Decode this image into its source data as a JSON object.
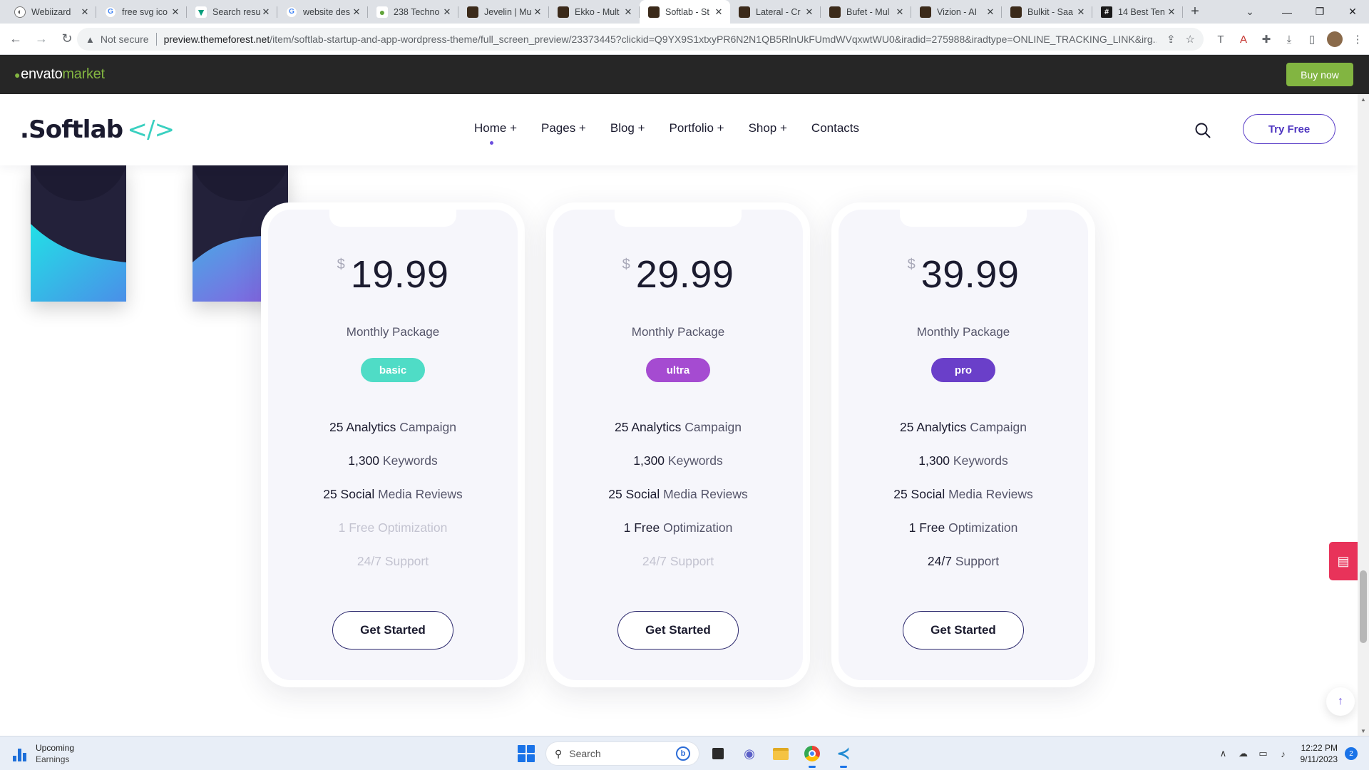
{
  "browser": {
    "tabs": [
      {
        "title": "Webiizard",
        "icon": "webiizard-icon",
        "active": false
      },
      {
        "title": "free svg ico",
        "icon": "google-icon",
        "active": false
      },
      {
        "title": "Search resu",
        "icon": "vector-icon",
        "active": false
      },
      {
        "title": "website des",
        "icon": "google-icon",
        "active": false
      },
      {
        "title": "238 Techno",
        "icon": "leaf-icon",
        "active": false
      },
      {
        "title": "Jevelin | Mu",
        "icon": "envato-icon",
        "active": false
      },
      {
        "title": "Ekko - Mult",
        "icon": "envato-icon",
        "active": false
      },
      {
        "title": "Softlab - St",
        "icon": "envato-icon",
        "active": true
      },
      {
        "title": "Lateral - Cr",
        "icon": "envato-icon",
        "active": false
      },
      {
        "title": "Bufet - Mul",
        "icon": "envato-icon",
        "active": false
      },
      {
        "title": "Vizion - AI",
        "icon": "envato-icon",
        "active": false
      },
      {
        "title": "Bulkit - Saa",
        "icon": "envato-icon",
        "active": false
      },
      {
        "title": "14 Best Ten",
        "icon": "hashnode-icon",
        "active": false
      }
    ],
    "address": {
      "security": "Not secure",
      "host": "preview.themeforest.net",
      "path": "/item/softlab-startup-and-app-wordpress-theme/full_screen_preview/23373445?clickid=Q9YX9S1xtxyPR6N2N1QB5RlnUkFUmdWVqxwtWU0&iradid=275988&iradtype=ONLINE_TRACKING_LINK&irg..."
    }
  },
  "envato": {
    "logo_word": "envato",
    "logo_market": "market",
    "buy_label": "Buy now",
    "accent": "#82b541"
  },
  "site": {
    "brand": ".Softlab",
    "brand_mark": "</>",
    "nav": [
      {
        "label": "Home +",
        "active": true
      },
      {
        "label": "Pages +",
        "active": false
      },
      {
        "label": "Blog +",
        "active": false
      },
      {
        "label": "Portfolio +",
        "active": false
      },
      {
        "label": "Shop +",
        "active": false
      },
      {
        "label": "Contacts",
        "active": false
      }
    ],
    "try_free": "Try Free",
    "accent": "#5a3ec8"
  },
  "pricing": [
    {
      "currency": "$",
      "price": "19.99",
      "package": "Monthly Package",
      "tier": "basic",
      "tier_color": "#4fdcc6",
      "features": [
        {
          "strong": "25 Analytics",
          "rest": " Campaign",
          "enabled": true
        },
        {
          "strong": "1,300",
          "rest": " Keywords",
          "enabled": true
        },
        {
          "strong": "25 Social",
          "rest": " Media Reviews",
          "enabled": true
        },
        {
          "strong": "1 Free",
          "rest": " Optimization",
          "enabled": false
        },
        {
          "strong": "24/7",
          "rest": " Support",
          "enabled": false
        }
      ],
      "cta": "Get Started"
    },
    {
      "currency": "$",
      "price": "29.99",
      "package": "Monthly Package",
      "tier": "ultra",
      "tier_color": "#a54bd1",
      "features": [
        {
          "strong": "25 Analytics",
          "rest": " Campaign",
          "enabled": true
        },
        {
          "strong": "1,300",
          "rest": " Keywords",
          "enabled": true
        },
        {
          "strong": "25 Social",
          "rest": " Media Reviews",
          "enabled": true
        },
        {
          "strong": "1 Free",
          "rest": " Optimization",
          "enabled": true
        },
        {
          "strong": "24/7",
          "rest": " Support",
          "enabled": false
        }
      ],
      "cta": "Get Started"
    },
    {
      "currency": "$",
      "price": "39.99",
      "package": "Monthly Package",
      "tier": "pro",
      "tier_color": "#6a3fc9",
      "features": [
        {
          "strong": "25 Analytics",
          "rest": " Campaign",
          "enabled": true
        },
        {
          "strong": "1,300",
          "rest": " Keywords",
          "enabled": true
        },
        {
          "strong": "25 Social",
          "rest": " Media Reviews",
          "enabled": true
        },
        {
          "strong": "1 Free",
          "rest": " Optimization",
          "enabled": true
        },
        {
          "strong": "24/7",
          "rest": " Support",
          "enabled": true
        }
      ],
      "cta": "Get Started"
    }
  ],
  "taskbar": {
    "widget_title": "Upcoming",
    "widget_sub": "Earnings",
    "search_placeholder": "Search",
    "time": "12:22 PM",
    "date": "9/11/2023",
    "notifications": "2"
  }
}
